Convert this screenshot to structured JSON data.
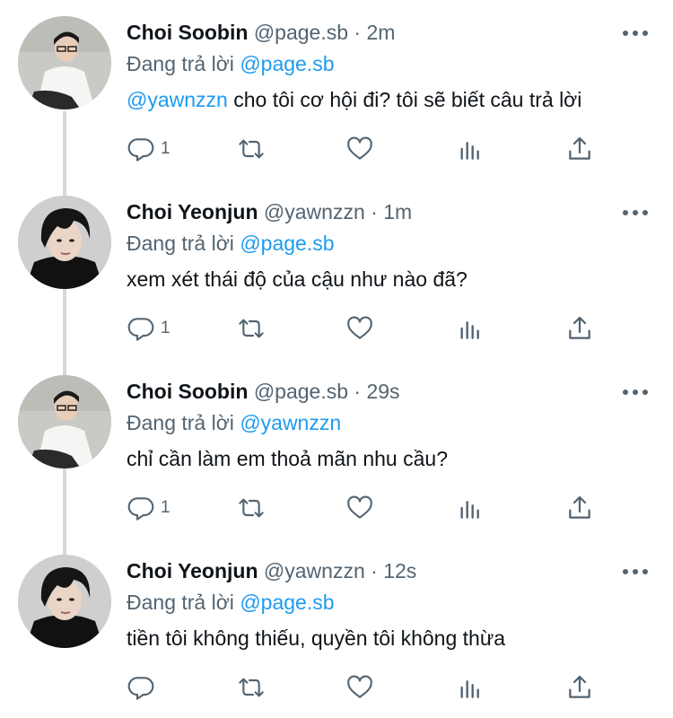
{
  "tweets": [
    {
      "name": "Choi Soobin",
      "handle": "@page.sb",
      "separator": "·",
      "time": "2m",
      "replying_label": "Đang trả lời",
      "replying_to": "@page.sb",
      "mention": "@yawnzzn",
      "text": " cho tôi cơ hội đi? tôi sẽ biết câu trả lời",
      "reply_count": "1",
      "avatar": "soobin-avatar"
    },
    {
      "name": "Choi Yeonjun",
      "handle": "@yawnzzn",
      "separator": "·",
      "time": "1m",
      "replying_label": "Đang trả lời",
      "replying_to": "@page.sb",
      "mention": "",
      "text": "xem xét thái độ của cậu như nào đã?",
      "reply_count": "1",
      "avatar": "yeonjun-avatar"
    },
    {
      "name": "Choi Soobin",
      "handle": "@page.sb",
      "separator": "·",
      "time": "29s",
      "replying_label": "Đang trả lời",
      "replying_to": "@yawnzzn",
      "mention": "",
      "text": "chỉ cần làm em thoả mãn nhu cầu?",
      "reply_count": "1",
      "avatar": "soobin-avatar"
    },
    {
      "name": "Choi Yeonjun",
      "handle": "@yawnzzn",
      "separator": "·",
      "time": "12s",
      "replying_label": "Đang trả lời",
      "replying_to": "@page.sb",
      "mention": "",
      "text": "tiền tôi không thiếu, quyền tôi không thừa",
      "reply_count": "",
      "avatar": "yeonjun-avatar"
    }
  ],
  "colors": {
    "link": "#1d9bf0",
    "secondary_text": "#536471",
    "primary_text": "#0f1419",
    "thread_line": "#cfd9de"
  },
  "icons": [
    "reply-icon",
    "retweet-icon",
    "like-icon",
    "views-icon",
    "share-icon",
    "more-icon"
  ]
}
